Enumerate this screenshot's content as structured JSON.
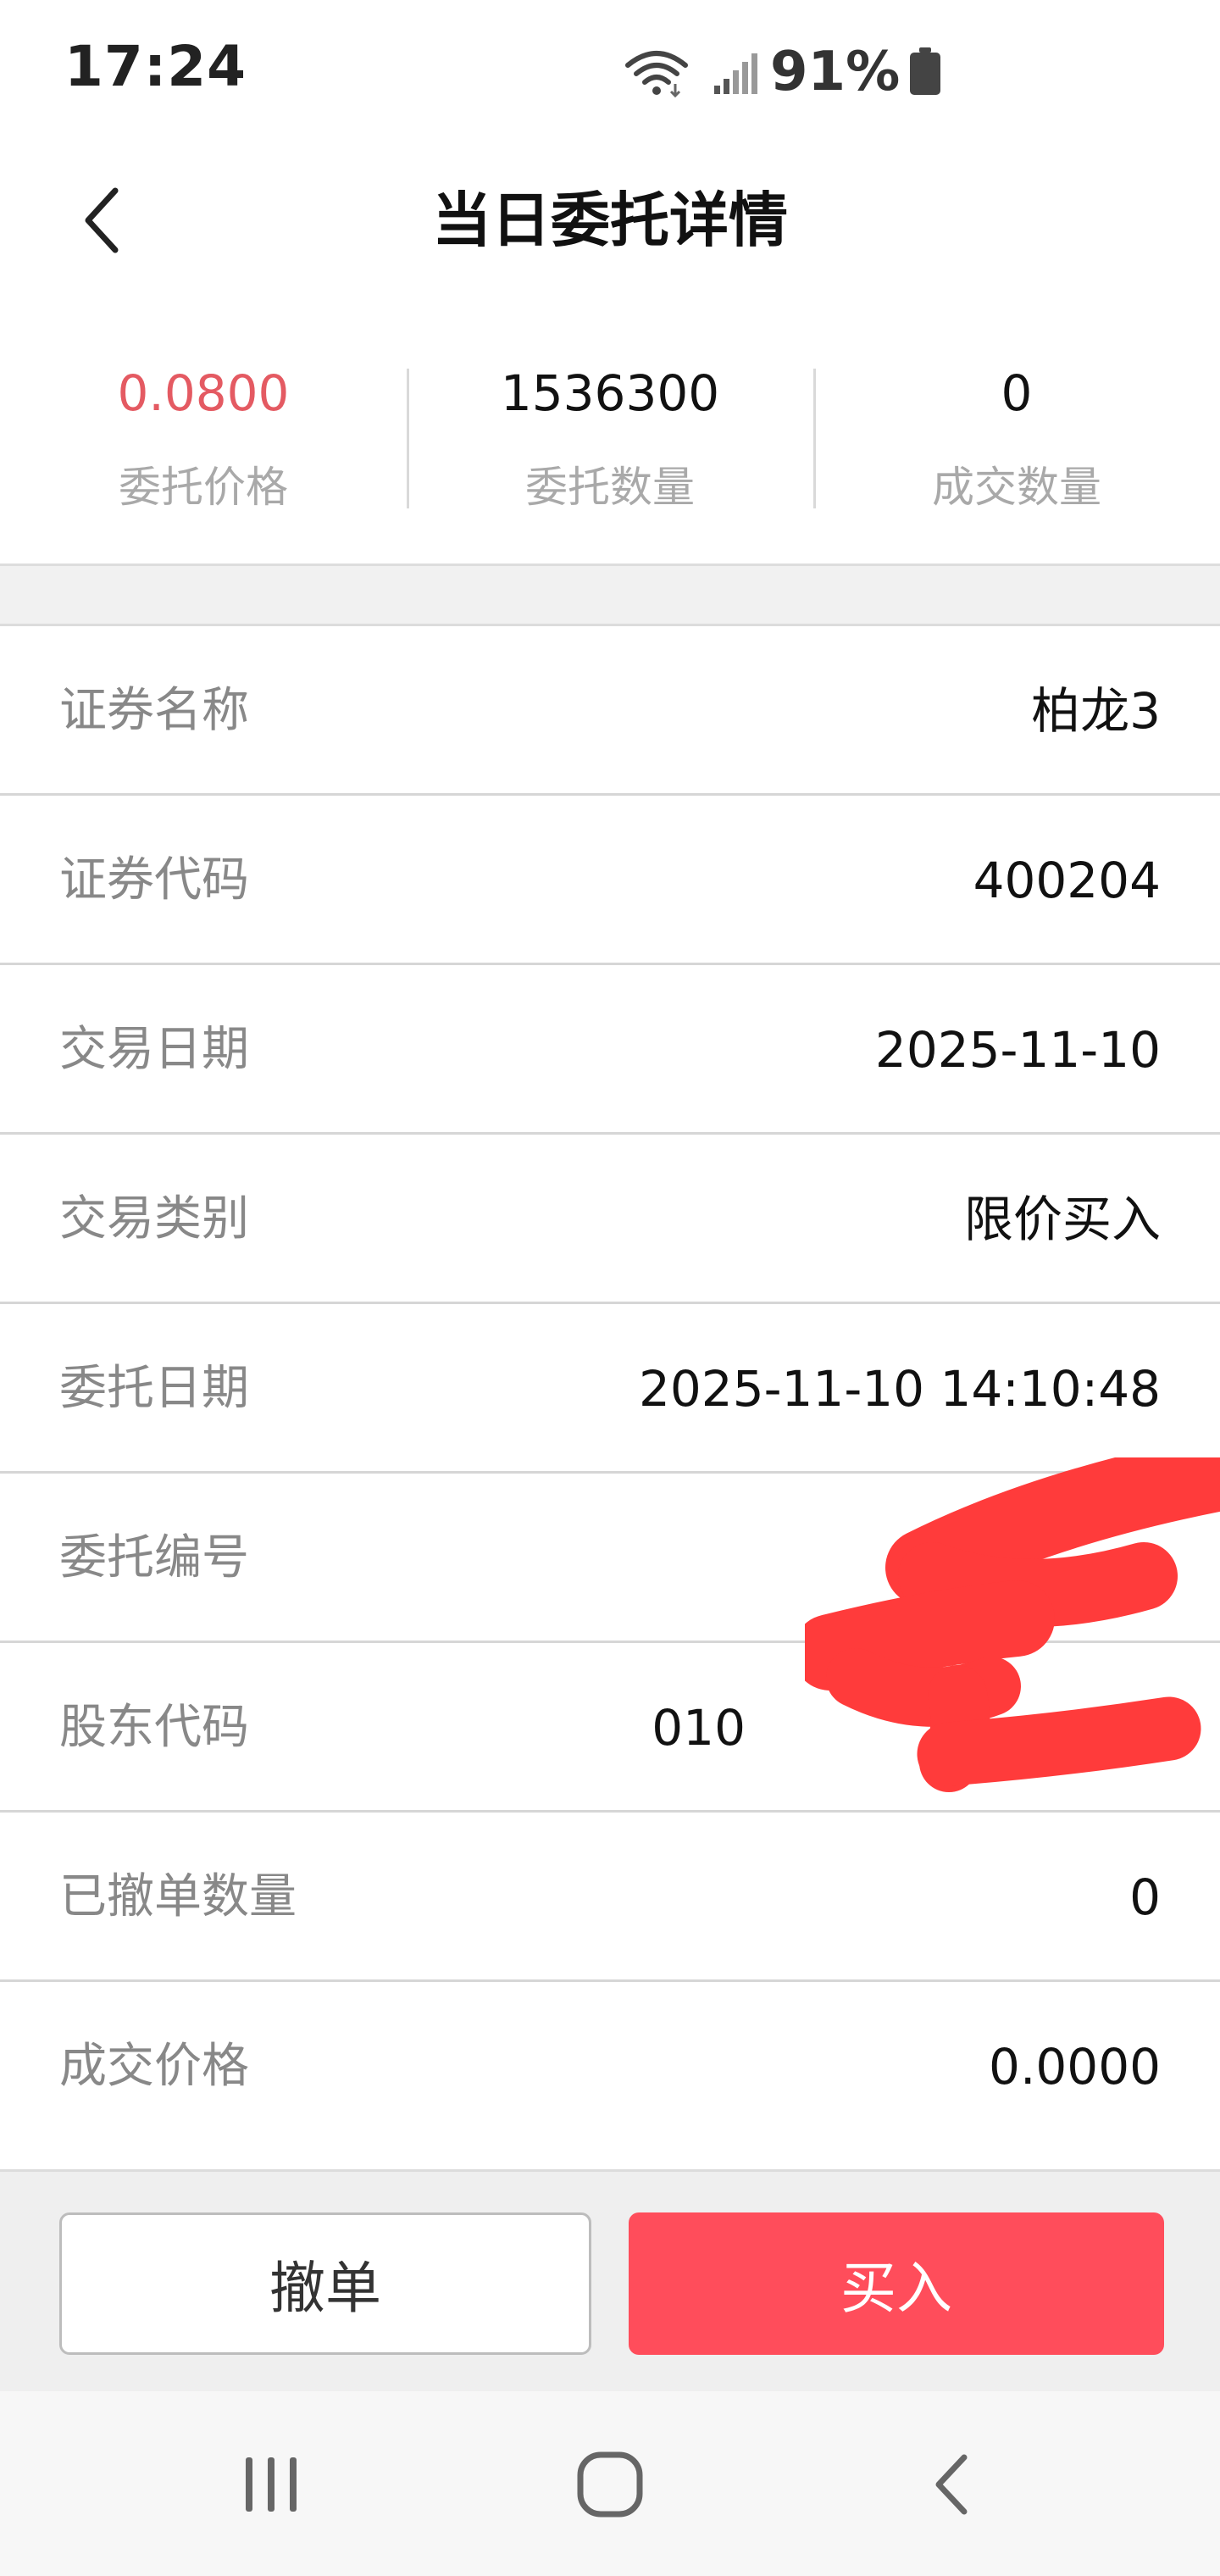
{
  "status_bar": {
    "time": "17:24",
    "battery": "91%"
  },
  "header": {
    "title": "当日委托详情"
  },
  "summary": [
    {
      "value": "0.0800",
      "label": "委托价格"
    },
    {
      "value": "1536300",
      "label": "委托数量"
    },
    {
      "value": "0",
      "label": "成交数量"
    }
  ],
  "details": [
    {
      "label": "证券名称",
      "value": "柏龙3"
    },
    {
      "label": "证券代码",
      "value": "400204"
    },
    {
      "label": "交易日期",
      "value": "2025-11-10"
    },
    {
      "label": "交易类别",
      "value": "限价买入"
    },
    {
      "label": "委托日期",
      "value": "2025-11-10 14:10:48"
    },
    {
      "label": "委托编号",
      "value": ""
    },
    {
      "label": "股东代码",
      "value": "010"
    },
    {
      "label": "已撤单数量",
      "value": "0"
    },
    {
      "label": "成交价格",
      "value": "0.0000"
    }
  ],
  "actions": {
    "cancel_label": "撤单",
    "buy_label": "买入"
  },
  "colors": {
    "price_red": "#e45a62",
    "buy_button": "#ff4d5b",
    "redaction": "#ff3b3b"
  },
  "icons": {
    "back": "chevron-left-icon",
    "recents": "recents-icon",
    "home": "home-icon",
    "system_back": "system-back-icon"
  }
}
